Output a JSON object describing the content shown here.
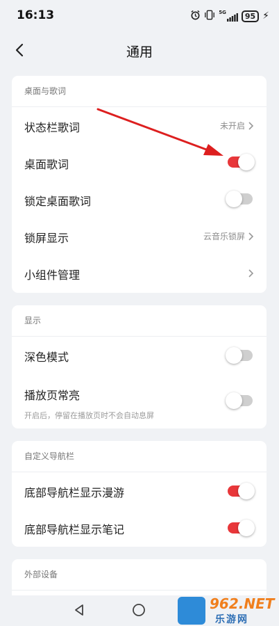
{
  "status_bar": {
    "time": "16:13",
    "network": "5G",
    "battery": "95"
  },
  "header": {
    "title": "通用"
  },
  "sections": [
    {
      "title": "桌面与歌词",
      "items": [
        {
          "label": "状态栏歌词",
          "value": "未开启",
          "control": "chevron"
        },
        {
          "label": "桌面歌词",
          "control": "toggle",
          "state": "on"
        },
        {
          "label": "锁定桌面歌词",
          "control": "toggle",
          "state": "off"
        },
        {
          "label": "锁屏显示",
          "value": "云音乐锁屏",
          "control": "chevron"
        },
        {
          "label": "小组件管理",
          "control": "chevron"
        }
      ]
    },
    {
      "title": "显示",
      "items": [
        {
          "label": "深色模式",
          "control": "toggle",
          "state": "off"
        },
        {
          "label": "播放页常亮",
          "description": "开启后，停留在播放页时不会自动息屏",
          "control": "toggle",
          "state": "off"
        }
      ]
    },
    {
      "title": "自定义导航栏",
      "items": [
        {
          "label": "底部导航栏显示漫游",
          "control": "toggle",
          "state": "on"
        },
        {
          "label": "底部导航栏显示笔记",
          "control": "toggle",
          "state": "on"
        }
      ]
    },
    {
      "title": "外部设备",
      "items": []
    }
  ],
  "watermark": {
    "brand": "962.NET",
    "site": "乐游网"
  },
  "colors": {
    "toggle_on": "#e8373a",
    "toggle_off": "#cfcfcf",
    "annotation_arrow": "#dd1f1f",
    "background": "#f0f2f5"
  }
}
